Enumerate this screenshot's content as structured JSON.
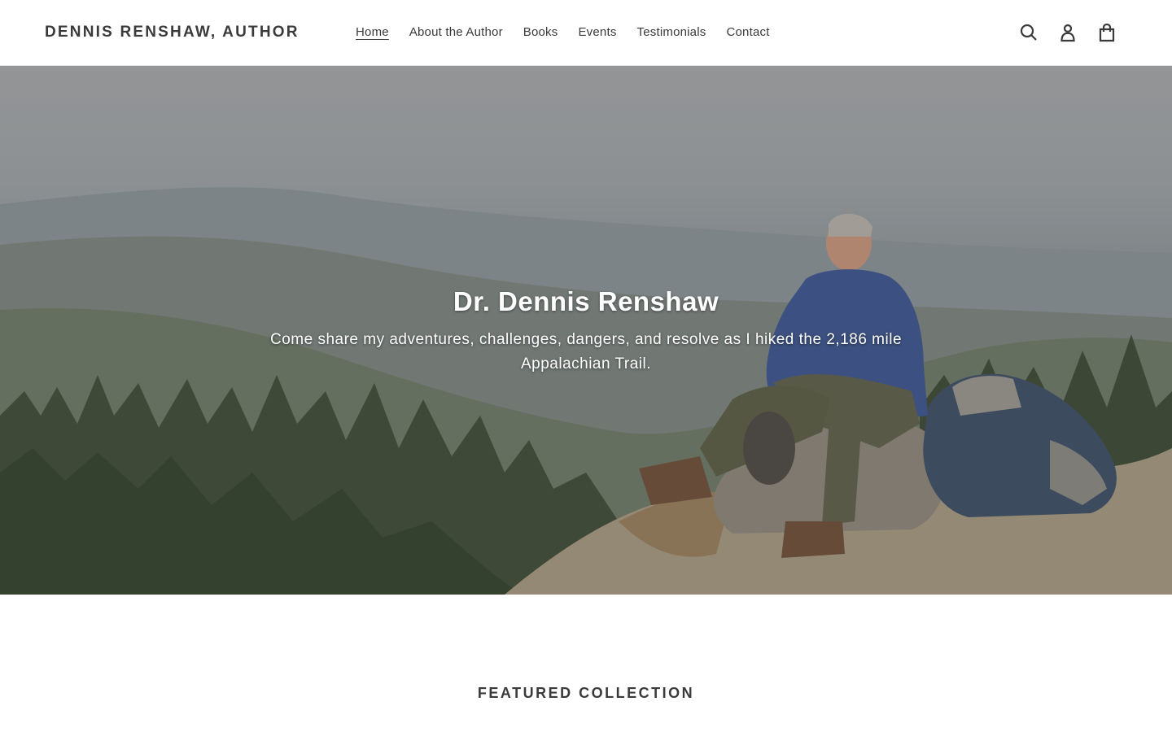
{
  "header": {
    "logo": "DENNIS RENSHAW, AUTHOR",
    "nav": [
      {
        "label": "Home",
        "active": true
      },
      {
        "label": "About the Author",
        "active": false
      },
      {
        "label": "Books",
        "active": false
      },
      {
        "label": "Events",
        "active": false
      },
      {
        "label": "Testimonials",
        "active": false
      },
      {
        "label": "Contact",
        "active": false
      }
    ],
    "icons": [
      "search-icon",
      "account-icon",
      "cart-icon"
    ]
  },
  "hero": {
    "title": "Dr. Dennis Renshaw",
    "subtitle": "Come share my adventures, challenges, dangers, and resolve as I hiked the 2,186 mile Appalachian Trail.",
    "image": "hiker-seated-on-rock-mountain-vista"
  },
  "featured": {
    "heading": "FEATURED COLLECTION"
  },
  "colors": {
    "text": "#3a3a3a",
    "background": "#ffffff",
    "hero_text": "#ffffff"
  }
}
